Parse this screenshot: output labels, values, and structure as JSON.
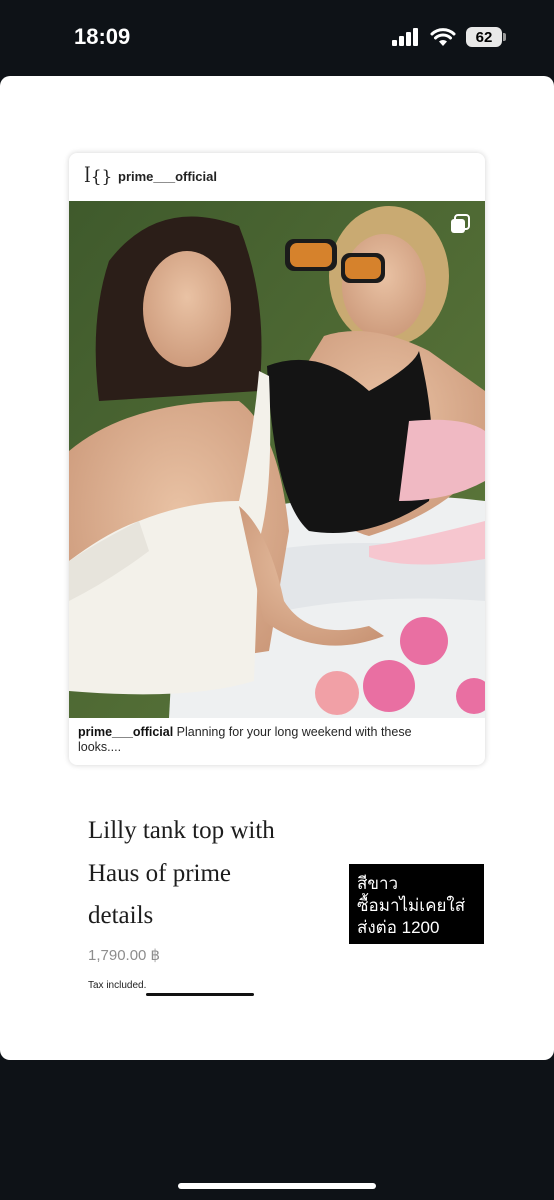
{
  "status_bar": {
    "time": "18:09",
    "battery": "62"
  },
  "post": {
    "username": "prime___official",
    "caption_user": "prime___official",
    "caption_text": " Planning for your long weekend with these looks....",
    "photo_icon": "multiple-photos-icon"
  },
  "product": {
    "title_lines": [
      "Lilly tank top with",
      "Haus of prime",
      "details"
    ],
    "price": "1,790.00 ฿",
    "tax_note": "Tax included."
  },
  "note": {
    "lines": [
      "สีขาว",
      "ซื้อมาไม่เคยใส่",
      "ส่งต่อ 1200"
    ]
  },
  "colors": {
    "background": "#0e1217",
    "sheet": "#ffffff",
    "note_box": "#000000"
  }
}
